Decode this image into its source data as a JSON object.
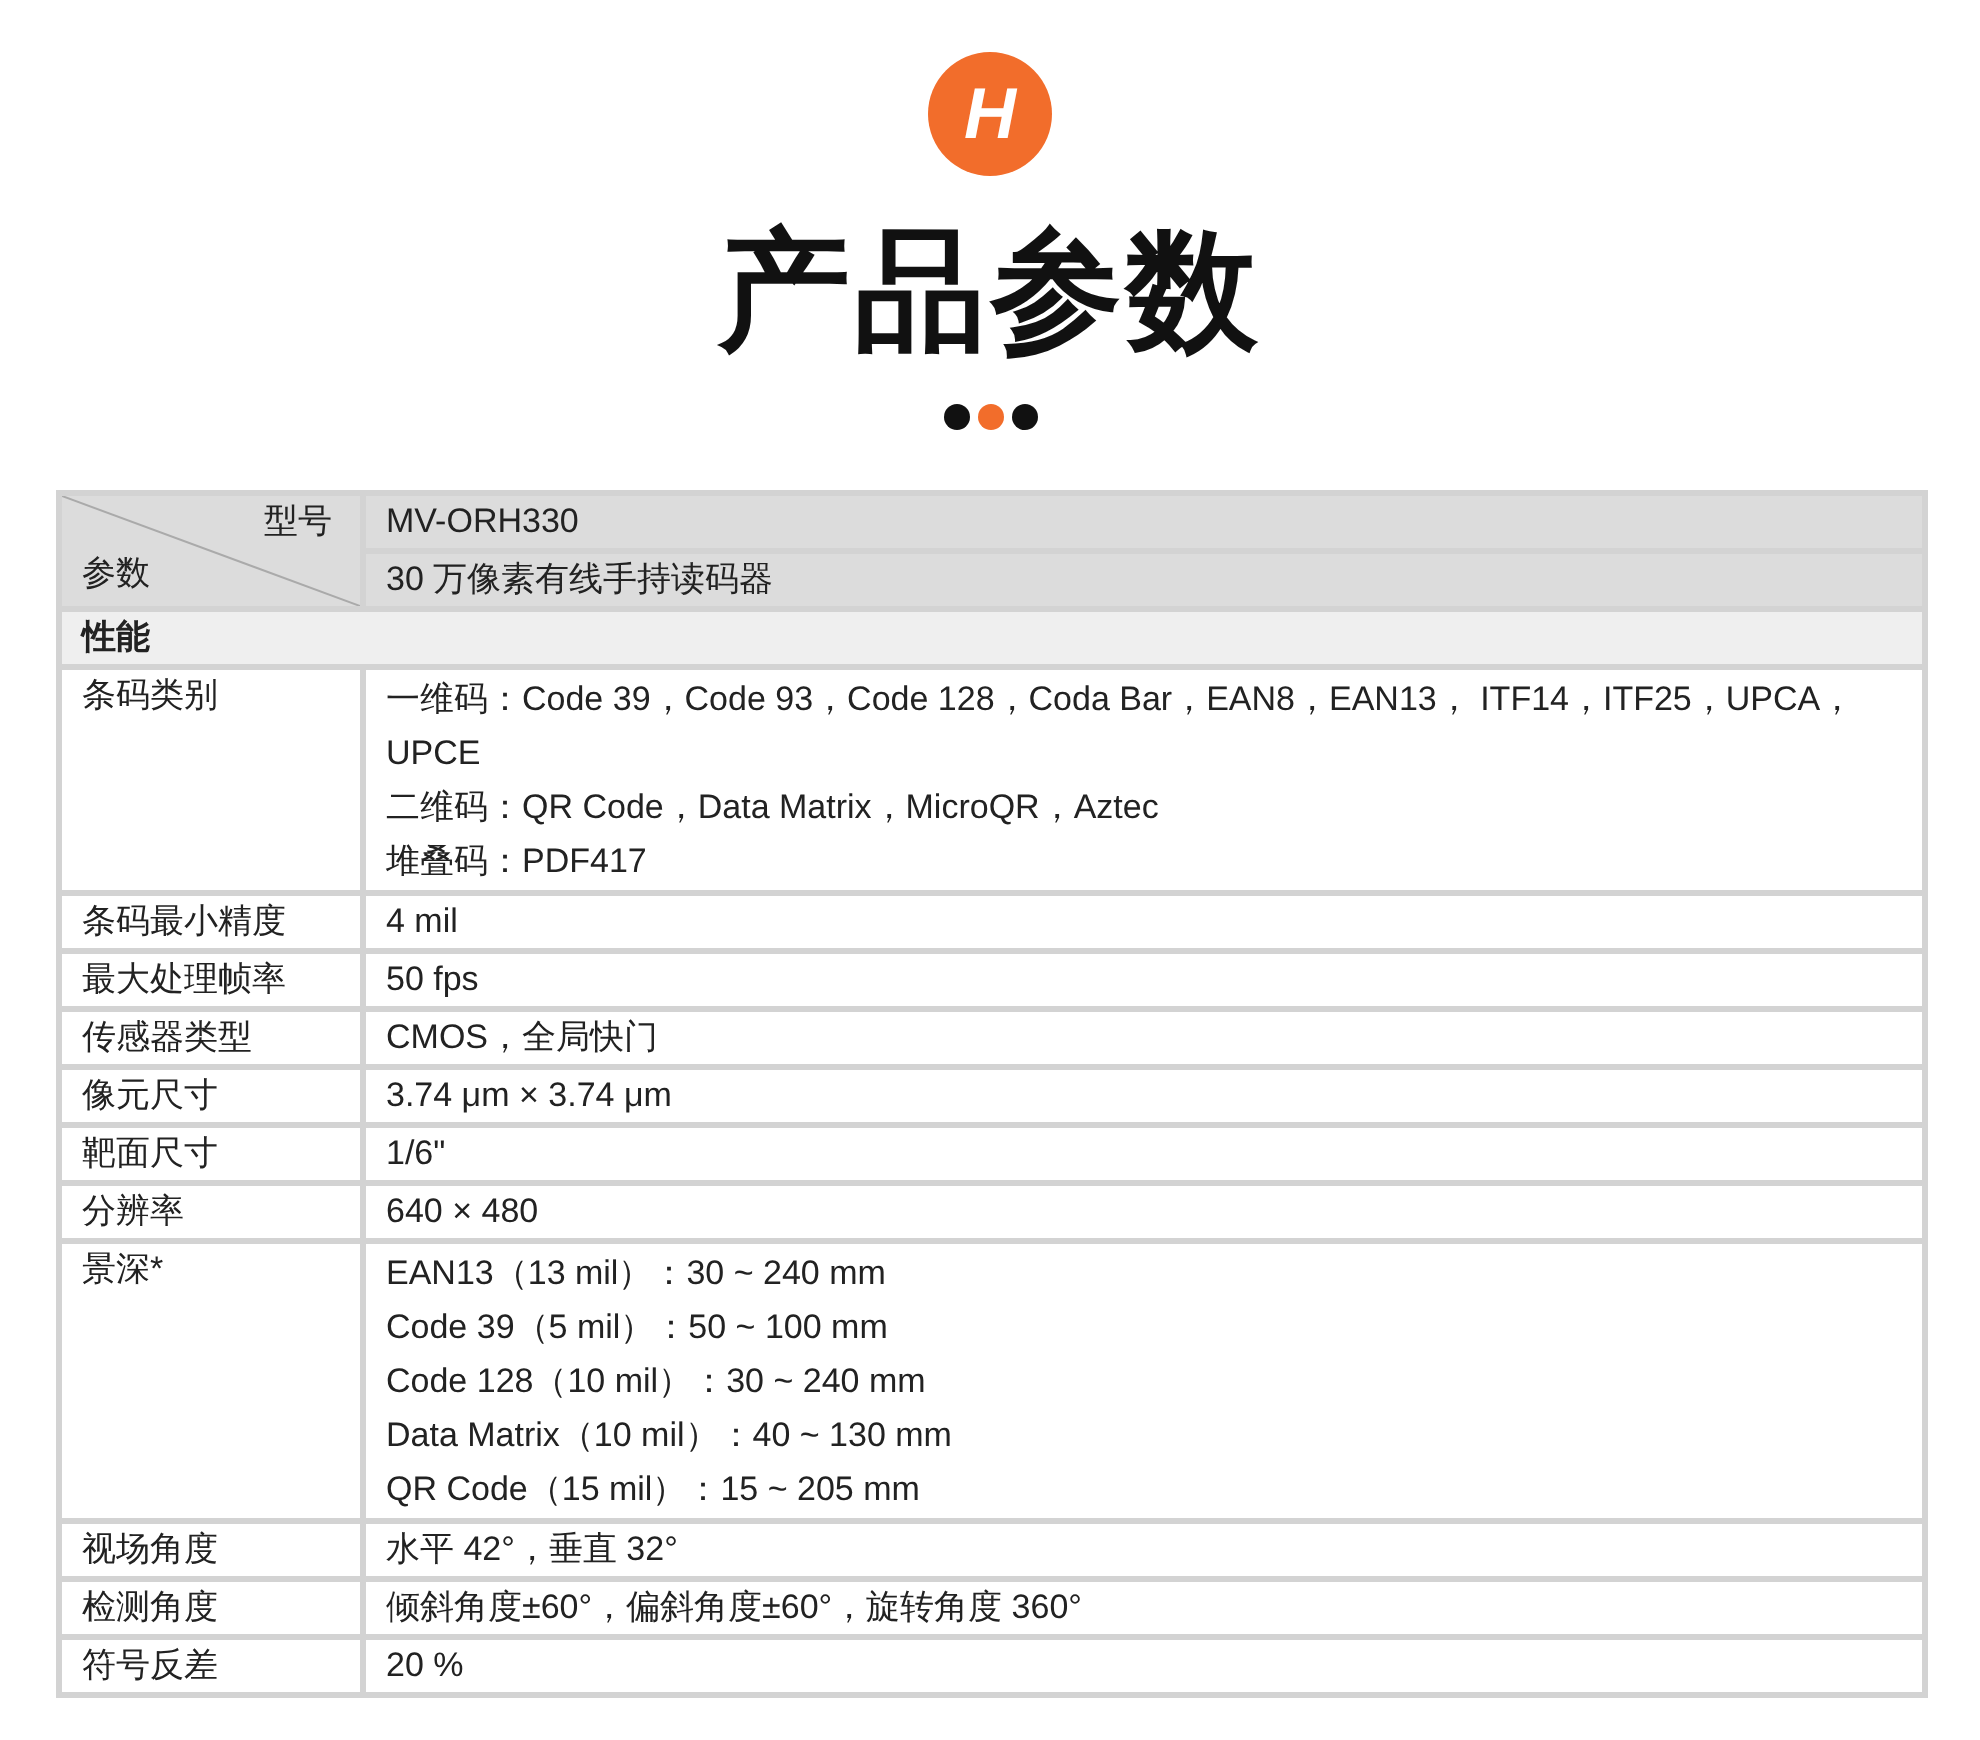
{
  "logo": {
    "letter": "H"
  },
  "title": "产品参数",
  "header": {
    "corner_top": "型号",
    "corner_bottom": "参数",
    "model": "MV-ORH330",
    "description": "30 万像素有线手持读码器"
  },
  "sections": [
    {
      "title": "性能",
      "rows": [
        {
          "label": "条码类别",
          "lines": [
            "一维码：Code 39，Code 93，Code 128，Coda Bar，EAN8，EAN13， ITF14，ITF25，UPCA，UPCE",
            "二维码：QR Code，Data Matrix，MicroQR，Aztec",
            "堆叠码：PDF417"
          ]
        },
        {
          "label": "条码最小精度",
          "lines": [
            "4 mil"
          ]
        },
        {
          "label": "最大处理帧率",
          "lines": [
            "50 fps"
          ]
        },
        {
          "label": "传感器类型",
          "lines": [
            "CMOS，全局快门"
          ]
        },
        {
          "label": "像元尺寸",
          "lines": [
            "3.74  μm × 3.74  μm"
          ]
        },
        {
          "label": "靶面尺寸",
          "lines": [
            "1/6\""
          ]
        },
        {
          "label": "分辨率",
          "lines": [
            "640 × 480"
          ]
        },
        {
          "label": "景深*",
          "lines": [
            "EAN13（13 mil）：30 ~ 240 mm",
            "Code 39（5 mil）：50 ~ 100 mm",
            "Code 128（10 mil）：30 ~ 240 mm",
            "Data Matrix（10 mil）：40 ~ 130 mm",
            "QR Code（15 mil）：15 ~ 205 mm"
          ]
        },
        {
          "label": "视场角度",
          "lines": [
            "水平 42°，垂直 32°"
          ]
        },
        {
          "label": "检测角度",
          "lines": [
            "倾斜角度±60°，偏斜角度±60°，旋转角度 360°"
          ]
        },
        {
          "label": "符号反差",
          "lines": [
            "20 %"
          ]
        }
      ]
    }
  ]
}
